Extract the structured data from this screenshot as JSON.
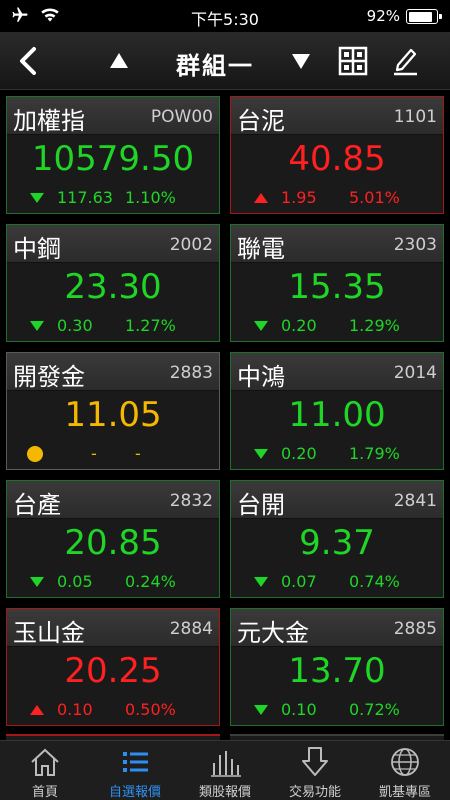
{
  "status": {
    "time": "下午5:30",
    "battery": "92%",
    "battery_level": 0.92
  },
  "header": {
    "title": "群組一"
  },
  "colors": {
    "up": "#ff2020",
    "down": "#1fd626",
    "flat": "#f5b800",
    "active_tab": "#2f8ff0"
  },
  "quotes": [
    {
      "name": "加權指",
      "code": "POW00",
      "price": "10579.50",
      "change": "117.63",
      "pct": "1.10%",
      "direction": "down"
    },
    {
      "name": "台泥",
      "code": "1101",
      "price": "40.85",
      "change": "1.95",
      "pct": "5.01%",
      "direction": "up"
    },
    {
      "name": "中鋼",
      "code": "2002",
      "price": "23.30",
      "change": "0.30",
      "pct": "1.27%",
      "direction": "down"
    },
    {
      "name": "聯電",
      "code": "2303",
      "price": "15.35",
      "change": "0.20",
      "pct": "1.29%",
      "direction": "down"
    },
    {
      "name": "開發金",
      "code": "2883",
      "price": "11.05",
      "change": "-",
      "pct": "-",
      "direction": "flat"
    },
    {
      "name": "中鴻",
      "code": "2014",
      "price": "11.00",
      "change": "0.20",
      "pct": "1.79%",
      "direction": "down"
    },
    {
      "name": "台產",
      "code": "2832",
      "price": "20.85",
      "change": "0.05",
      "pct": "0.24%",
      "direction": "down"
    },
    {
      "name": "台開",
      "code": "2841",
      "price": "9.37",
      "change": "0.07",
      "pct": "0.74%",
      "direction": "down"
    },
    {
      "name": "玉山金",
      "code": "2884",
      "price": "20.25",
      "change": "0.10",
      "pct": "0.50%",
      "direction": "up"
    },
    {
      "name": "元大金",
      "code": "2885",
      "price": "13.70",
      "change": "0.10",
      "pct": "0.72%",
      "direction": "down"
    }
  ],
  "tabs": [
    {
      "label": "首頁",
      "icon": "home-icon",
      "active": false
    },
    {
      "label": "自選報價",
      "icon": "list-icon",
      "active": true
    },
    {
      "label": "類股報價",
      "icon": "bar-chart-icon",
      "active": false
    },
    {
      "label": "交易功能",
      "icon": "download-arrow-icon",
      "active": false
    },
    {
      "label": "凱基專區",
      "icon": "globe-icon",
      "active": false
    }
  ]
}
